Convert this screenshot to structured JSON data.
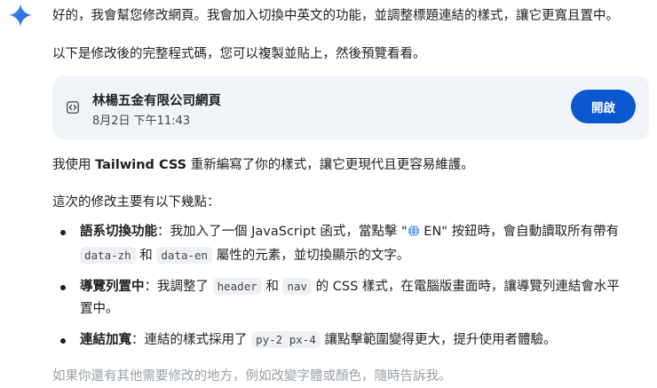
{
  "intro": {
    "line1": "好的，我會幫您修改網頁。我會加入切換中英文的功能，並調整標題連結的樣式，讓它更寬且置中。",
    "line2": "以下是修改後的完整程式碼，您可以複製並貼上，然後預覽看看。"
  },
  "card": {
    "title": "林楊五金有限公司網頁",
    "date": "8月2日 下午11:43",
    "open_label": "開啟"
  },
  "summary": {
    "prefix": "我使用 ",
    "bold": "Tailwind CSS",
    "suffix": " 重新編寫了你的樣式，讓它更現代且更容易維護。"
  },
  "points_intro": "這次的修改主要有以下幾點：",
  "points": [
    {
      "title": "語系切換功能",
      "text_a": "：我加入了一個 JavaScript 函式，當點擊 \"",
      "text_b": " EN\" 按鈕時，會自動讀取所有帶有",
      "code1": "data-zh",
      "mid": " 和 ",
      "code2": "data-en",
      "text_c": " 屬性的元素，並切換顯示的文字。"
    },
    {
      "title": "導覽列置中",
      "text_a": "：我調整了 ",
      "code1": "header",
      "mid": " 和 ",
      "code2": "nav",
      "text_b": " 的 CSS 樣式，在電腦版畫面時，讓導覽列連結會水平",
      "text_c": "置中。"
    },
    {
      "title": "連結加寬",
      "text_a": "：連結的樣式採用了 ",
      "code1": "py-2 px-4",
      "text_b": " 讓點擊範圍變得更大，提升使用者體驗。"
    }
  ],
  "closing": "如果你還有其他需要修改的地方，例如改變字體或顏色，隨時告訴我。",
  "colors": {
    "accent": "#0b57d0",
    "card_bg": "#f0f4f9",
    "text": "#1f1f1f",
    "faded": "#9aa0a6"
  },
  "icons": {
    "assistant": "sparkle-icon",
    "card": "code-icon",
    "lang": "globe-icon"
  }
}
